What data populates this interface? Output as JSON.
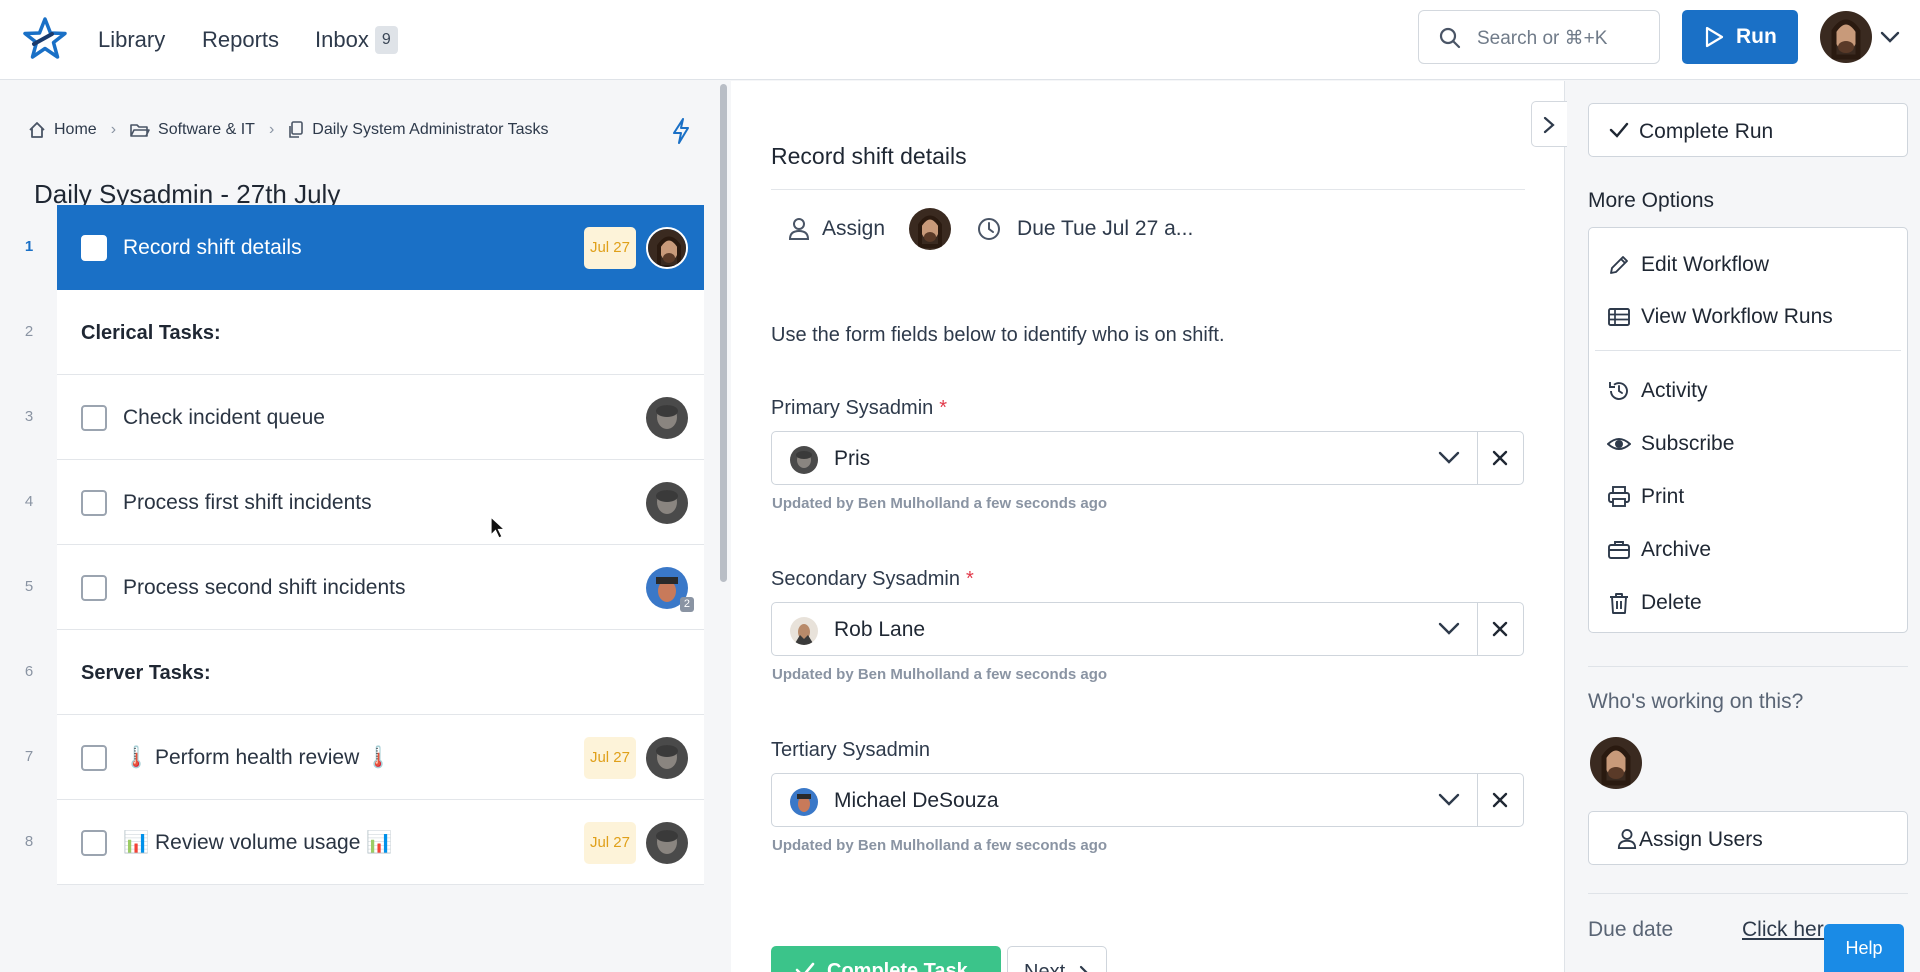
{
  "topbar": {
    "nav": [
      "Library",
      "Reports",
      "Inbox"
    ],
    "inbox_count": "9",
    "search_placeholder": "Search or ⌘+K",
    "run_label": "Run"
  },
  "breadcrumb": [
    "Home",
    "Software & IT",
    "Daily System Administrator Tasks"
  ],
  "run_title": "Daily Sysadmin - 27th July",
  "tasks": [
    {
      "num": "1",
      "label": "Record shift details",
      "due": "Jul 27",
      "kind": "task"
    },
    {
      "num": "2",
      "label": "Clerical Tasks:",
      "kind": "heading"
    },
    {
      "num": "3",
      "label": "Check incident queue",
      "kind": "task"
    },
    {
      "num": "4",
      "label": "Process first shift incidents",
      "kind": "task"
    },
    {
      "num": "5",
      "label": "Process second shift incidents",
      "kind": "task",
      "avatar_count": "2"
    },
    {
      "num": "6",
      "label": "Server Tasks:",
      "kind": "heading"
    },
    {
      "num": "7",
      "label": "🌡️ Perform health review 🌡️",
      "due": "Jul 27",
      "kind": "task"
    },
    {
      "num": "8",
      "label": "📊 Review volume usage 📊",
      "due": "Jul 27",
      "kind": "task"
    }
  ],
  "task_detail": {
    "title": "Record shift details",
    "assign_label": "Assign",
    "due_text": "Due Tue Jul 27 a...",
    "intro": "Use the form fields below to identify who is on shift.",
    "fields": [
      {
        "label": "Primary Sysadmin",
        "required_mark": "*",
        "value": "Pris",
        "note": "Updated by Ben Mulholland a few seconds ago"
      },
      {
        "label": "Secondary Sysadmin",
        "required_mark": "*",
        "value": "Rob Lane",
        "note": "Updated by Ben Mulholland a few seconds ago"
      },
      {
        "label": "Tertiary Sysadmin",
        "required_mark": "",
        "value": "Michael DeSouza",
        "note": "Updated by Ben Mulholland a few seconds ago"
      }
    ],
    "complete_task_label": "Complete Task",
    "next_label": "Next"
  },
  "sidebar": {
    "complete_run_label": "Complete Run",
    "more_options_title": "More Options",
    "options": [
      "Edit Workflow",
      "View Workflow Runs",
      "Activity",
      "Subscribe",
      "Print",
      "Archive",
      "Delete"
    ],
    "working_title": "Who's working on this?",
    "assign_users_label": "Assign Users",
    "due_date_label": "Due date",
    "due_date_link": "Click here"
  },
  "help_label": "Help",
  "colors": {
    "primary": "#1a70c6",
    "success": "#3bc48a",
    "due_badge_bg": "#fdf3d9",
    "due_badge_text": "#e0a01a",
    "required": "#e23a4b"
  }
}
